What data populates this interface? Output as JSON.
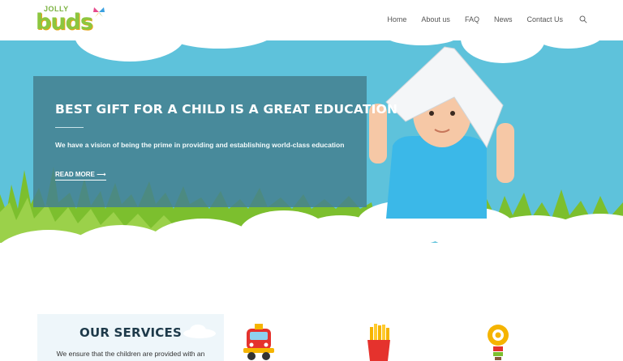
{
  "brand": {
    "logo_top": "JOLLY",
    "logo_main": "buds"
  },
  "nav": {
    "items": [
      "Home",
      "About us",
      "FAQ",
      "News",
      "Contact Us"
    ]
  },
  "hero": {
    "title": "BEST GIFT FOR A CHILD IS A GREAT EDUCATION",
    "subtitle": "We have a vision of being the prime in providing and establishing world-class education",
    "cta": "READ MORE"
  },
  "services": {
    "title": "OUR SERVICES",
    "text": "We ensure that the children are provided with an"
  },
  "colors": {
    "sky": "#5ec2db",
    "panel": "#44808f",
    "grass": "#8cc63f",
    "title": "#1e3a4a"
  },
  "icons": [
    "search-icon",
    "butterfly-icon",
    "bus-icon",
    "fries-icon",
    "lightbulb-icon",
    "arrow-right-icon"
  ]
}
